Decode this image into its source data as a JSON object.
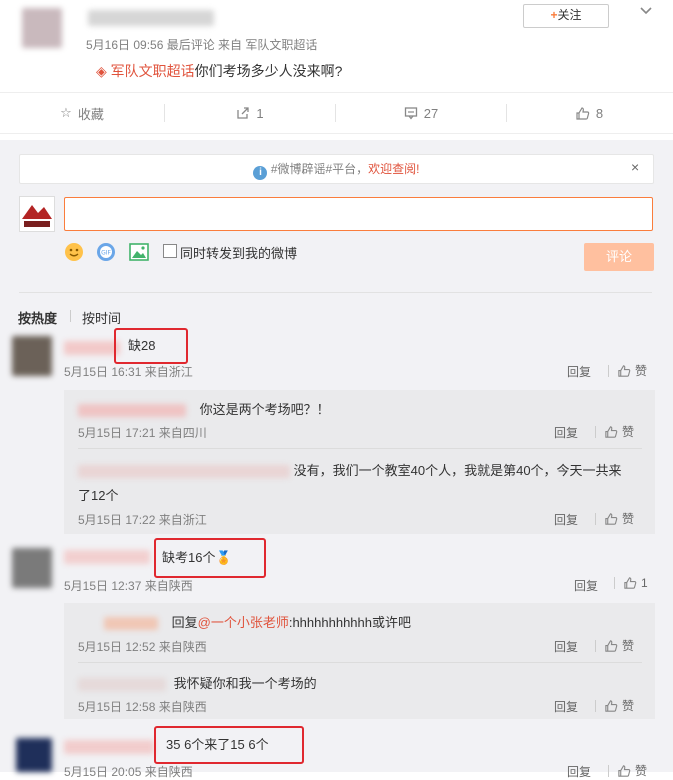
{
  "post": {
    "time": "5月16日 09:56 最后评论 来自 军队文职超话",
    "follow_label": "关注",
    "topic": "军队文职超话",
    "text": "你们考场多少人没来啊?"
  },
  "actions": {
    "favorite": "收藏",
    "repost": "1",
    "comments": "27",
    "likes": "8"
  },
  "notice": {
    "text": "#微博辟谣#平台，",
    "link": "欢迎查阅!"
  },
  "composer": {
    "repost_option": "同时转发到我的微博",
    "submit": "评论"
  },
  "sort": {
    "hot": "按热度",
    "time": "按时间"
  },
  "comments": [
    {
      "text": "缺28",
      "meta": "5月15日 16:31 来自浙江",
      "reply_label": "回复",
      "like_label": "赞",
      "replies": [
        {
          "text": "你这是两个考场吧？！",
          "meta": "5月15日 17:21 来自四川",
          "reply_label": "回复",
          "like_label": "赞"
        },
        {
          "text": "没有，我们一个教室40个人，我就是第40个，今天一共来",
          "text2": "了12个",
          "meta": "5月15日 17:22 来自浙江",
          "reply_label": "回复",
          "like_label": "赞"
        }
      ]
    },
    {
      "text": "缺考16个",
      "meta": "5月15日 12:37 来自陕西",
      "reply_label": "回复",
      "like_label": "1",
      "replies": [
        {
          "prefix": "回复",
          "mention": "@一个小张老师",
          "text": ":hhhhhhhhhhh或许吧",
          "meta": "5月15日 12:52 来自陕西",
          "reply_label": "回复",
          "like_label": "赞"
        },
        {
          "text": "我怀疑你和我一个考场的",
          "meta": "5月15日 12:58 来自陕西",
          "reply_label": "回复",
          "like_label": "赞"
        }
      ]
    },
    {
      "text": "35 6个来了15 6个",
      "meta": "5月15日 20:05 来自陕西",
      "reply_label": "回复",
      "like_label": "赞"
    }
  ],
  "colors": {
    "accent": "#e0533c",
    "highlight": "#e0282f",
    "meta": "#808080"
  }
}
